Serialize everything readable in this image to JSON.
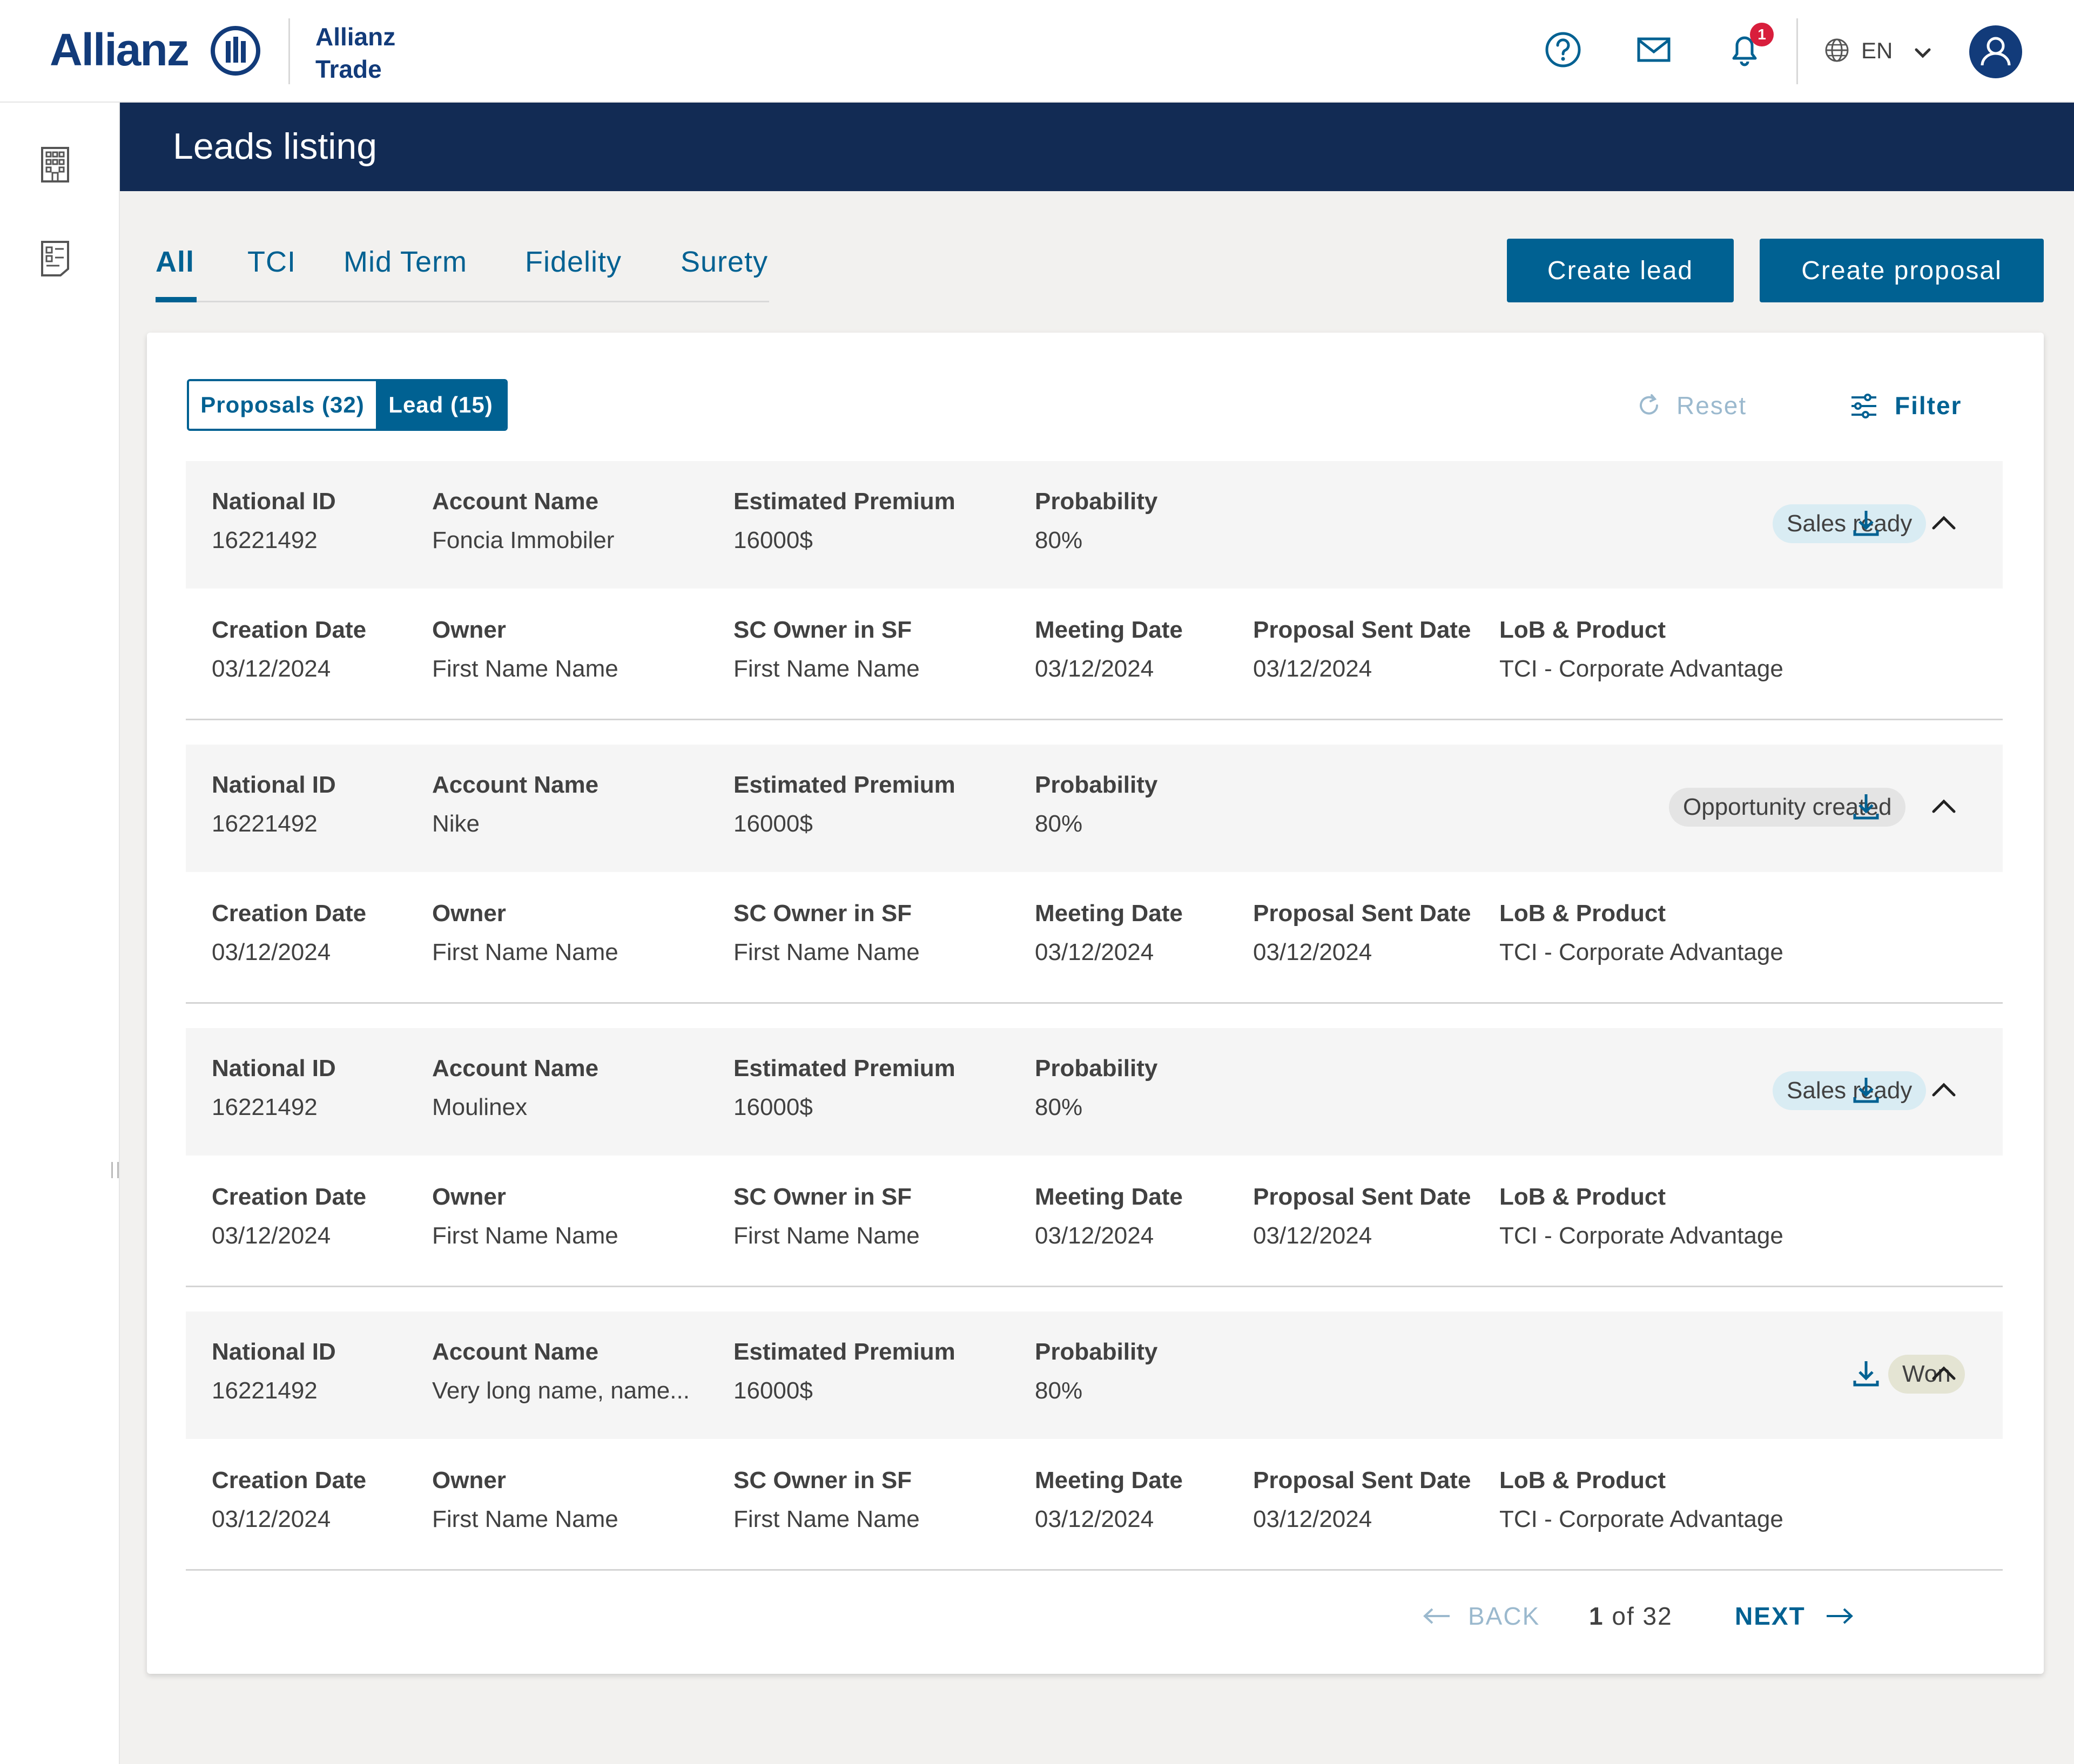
{
  "brand": {
    "logo": "Allianz",
    "product_line1": "Allianz",
    "product_line2": "Trade"
  },
  "header": {
    "notification_count": "1",
    "language": "EN"
  },
  "page": {
    "title": "Leads listing"
  },
  "tabs": [
    {
      "label": "All",
      "active": true
    },
    {
      "label": "TCI"
    },
    {
      "label": "Mid Term"
    },
    {
      "label": "Fidelity"
    },
    {
      "label": "Surety"
    }
  ],
  "actions": {
    "create_lead": "Create lead",
    "create_proposal": "Create proposal"
  },
  "toggle": {
    "proposals": "Proposals (32)",
    "lead": "Lead (15)"
  },
  "toolbar": {
    "reset": "Reset",
    "filter": "Filter"
  },
  "labels": {
    "national_id": "National ID",
    "account_name": "Account Name",
    "estimated_premium": "Estimated Premium",
    "probability": "Probability",
    "creation_date": "Creation Date",
    "owner": "Owner",
    "sc_owner": "SC Owner in SF",
    "meeting_date": "Meeting Date",
    "proposal_sent_date": "Proposal Sent Date",
    "lob_product": "LoB & Product"
  },
  "leads": [
    {
      "national_id": "16221492",
      "account_name": "Foncia Immobiler",
      "estimated_premium": "16000$",
      "probability": "80%",
      "status": "Sales ready",
      "creation_date": "03/12/2024",
      "owner": "First Name Name",
      "sc_owner": "First Name Name",
      "meeting_date": "03/12/2024",
      "proposal_sent_date": "03/12/2024",
      "lob_product": "TCI - Corporate Advantage"
    },
    {
      "national_id": "16221492",
      "account_name": "Nike",
      "estimated_premium": "16000$",
      "probability": "80%",
      "status": "Opportunity  created",
      "creation_date": "03/12/2024",
      "owner": "First Name Name",
      "sc_owner": "First Name Name",
      "meeting_date": "03/12/2024",
      "proposal_sent_date": "03/12/2024",
      "lob_product": "TCI - Corporate Advantage"
    },
    {
      "national_id": "16221492",
      "account_name": "Moulinex",
      "estimated_premium": "16000$",
      "probability": "80%",
      "status": "Sales ready",
      "creation_date": "03/12/2024",
      "owner": "First Name Name",
      "sc_owner": "First Name Name",
      "meeting_date": "03/12/2024",
      "proposal_sent_date": "03/12/2024",
      "lob_product": "TCI - Corporate Advantage"
    },
    {
      "national_id": "16221492",
      "account_name": "Very long name, name...",
      "estimated_premium": "16000$",
      "probability": "80%",
      "status": "Won",
      "creation_date": "03/12/2024",
      "owner": "First Name Name",
      "sc_owner": "First Name Name",
      "meeting_date": "03/12/2024",
      "proposal_sent_date": "03/12/2024",
      "lob_product": "TCI - Corporate Advantage"
    }
  ],
  "pagination": {
    "back": "BACK",
    "current": "1",
    "of": "of",
    "total": "32",
    "next": "NEXT"
  },
  "icons": {
    "help": "help-circle-icon",
    "mail": "mail-icon",
    "bell": "bell-icon",
    "globe": "globe-icon",
    "chevron": "chevron-down-icon",
    "user": "user-icon",
    "building": "building-icon",
    "document": "document-list-icon",
    "reset": "refresh-icon",
    "filter": "sliders-icon",
    "download": "download-icon",
    "collapse": "chevron-up-icon",
    "back": "arrow-left-icon",
    "next": "arrow-right-icon"
  },
  "colors": {
    "brand_navy": "#123b7a",
    "banner": "#122b54",
    "primary": "#006192",
    "badge_red": "#d81e3c",
    "sales_ready_bg": "#d9ecf3",
    "opportunity_bg": "#e4e4e4",
    "won_bg": "#e4e4d3"
  }
}
